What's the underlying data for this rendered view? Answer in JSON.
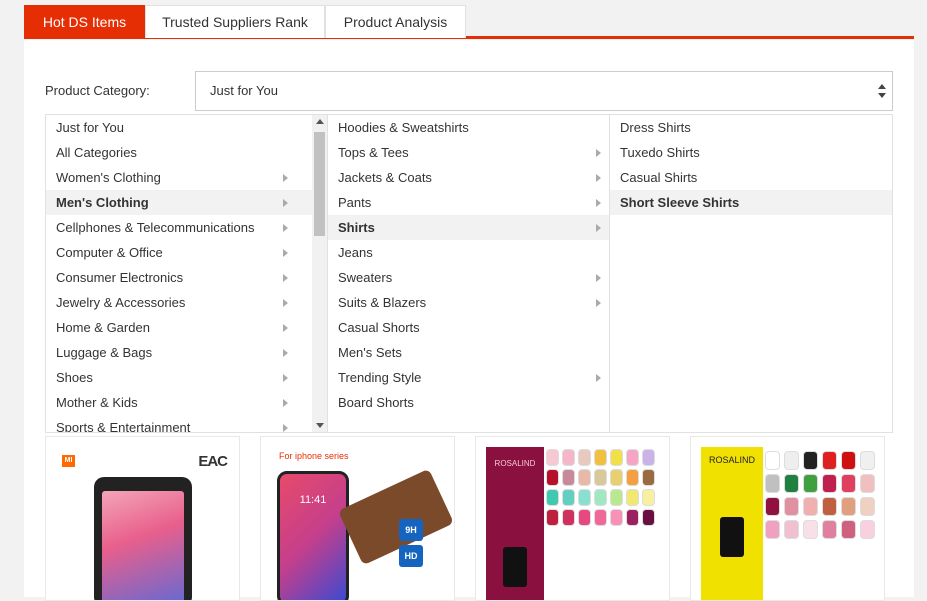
{
  "tabs": [
    {
      "label": "Hot DS Items",
      "active": true
    },
    {
      "label": "Trusted Suppliers Rank",
      "active": false
    },
    {
      "label": "Product Analysis",
      "active": false
    }
  ],
  "category": {
    "label": "Product Category:",
    "selected_value": "Just for You"
  },
  "columns": {
    "level1": [
      {
        "label": "Just for You",
        "has_children": false
      },
      {
        "label": "All Categories",
        "has_children": false
      },
      {
        "label": "Women's Clothing",
        "has_children": true
      },
      {
        "label": "Men's Clothing",
        "has_children": true,
        "selected": true
      },
      {
        "label": "Cellphones & Telecommunications",
        "has_children": true
      },
      {
        "label": "Computer & Office",
        "has_children": true
      },
      {
        "label": "Consumer Electronics",
        "has_children": true
      },
      {
        "label": "Jewelry & Accessories",
        "has_children": true
      },
      {
        "label": "Home & Garden",
        "has_children": true
      },
      {
        "label": "Luggage & Bags",
        "has_children": true
      },
      {
        "label": "Shoes",
        "has_children": true
      },
      {
        "label": "Mother & Kids",
        "has_children": true
      },
      {
        "label": "Sports & Entertainment",
        "has_children": true
      }
    ],
    "level2": [
      {
        "label": "Hoodies & Sweatshirts",
        "has_children": false
      },
      {
        "label": "Tops & Tees",
        "has_children": true
      },
      {
        "label": "Jackets & Coats",
        "has_children": true
      },
      {
        "label": "Pants",
        "has_children": true
      },
      {
        "label": "Shirts",
        "has_children": true,
        "selected": true
      },
      {
        "label": "Jeans",
        "has_children": false
      },
      {
        "label": "Sweaters",
        "has_children": true
      },
      {
        "label": "Suits & Blazers",
        "has_children": true
      },
      {
        "label": "Casual Shorts",
        "has_children": false
      },
      {
        "label": "Men's Sets",
        "has_children": false
      },
      {
        "label": "Trending Style",
        "has_children": true
      },
      {
        "label": "Board Shorts",
        "has_children": false
      }
    ],
    "level3": [
      {
        "label": "Dress Shirts",
        "has_children": false
      },
      {
        "label": "Tuxedo Shirts",
        "has_children": false
      },
      {
        "label": "Casual Shirts",
        "has_children": false
      },
      {
        "label": "Short Sleeve Shirts",
        "has_children": false,
        "selected": true
      }
    ]
  },
  "products": [
    {
      "brand": "MI",
      "mark": "EAC"
    },
    {
      "caption": "For iphone series",
      "time": "11:41",
      "badges": [
        "9H",
        "HD"
      ]
    },
    {
      "brand": "ROSALIND"
    },
    {
      "brand": "ROSALIND"
    }
  ],
  "colors": {
    "accent": "#e62e04",
    "selected_bg": "#f2f2f2"
  }
}
